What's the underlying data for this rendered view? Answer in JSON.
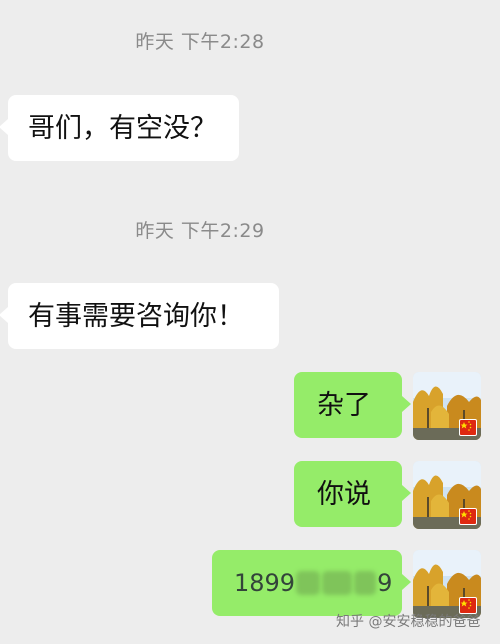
{
  "chat": {
    "messages": [
      {
        "time": "昨天 下午2:28",
        "text": "哥们，有空没？",
        "side": "left"
      },
      {
        "time": "昨天 下午2:29",
        "text": "有事需要咨询你！",
        "side": "left"
      },
      {
        "text": "杂了",
        "side": "right"
      },
      {
        "text": "你说",
        "side": "right"
      },
      {
        "text": "1899",
        "text_tail": "9",
        "side": "right"
      }
    ]
  },
  "watermark": {
    "text": "知乎 @安安稳稳的爸爸"
  },
  "colors": {
    "background": "#ededed",
    "incoming_bubble": "#ffffff",
    "outgoing_bubble": "#95ec69",
    "timestamp": "#8a8a8a"
  },
  "icons": {
    "avatar": "autumn-tree-avatar",
    "badge": "china-flag-badge"
  }
}
